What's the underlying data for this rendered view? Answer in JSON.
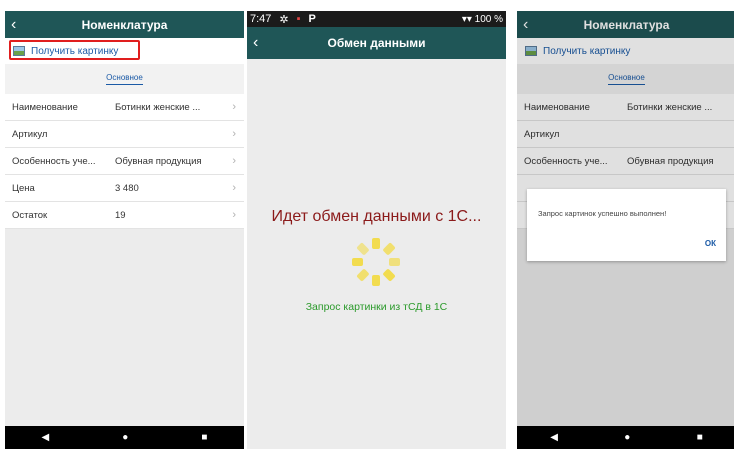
{
  "colors": {
    "appbar_teal": "#1f5657",
    "red_highlight": "#e01e1e",
    "link_blue": "#1b5aa6",
    "status_green": "#2b9a2b",
    "exchange_red": "#8b1a1a"
  },
  "screen1": {
    "back_icon": "‹",
    "title": "Номенклатура",
    "action_label": "Получить картинку",
    "tab": "Основное",
    "rows": [
      {
        "label": "Наименование",
        "value": "Ботинки женские ..."
      },
      {
        "label": "Артикул",
        "value": ""
      },
      {
        "label": "Особенность уче...",
        "value": "Обувная продукция"
      },
      {
        "label": "Цена",
        "value": "3 480"
      },
      {
        "label": "Остаток",
        "value": "19"
      }
    ],
    "nav": {
      "back": "◀",
      "home": "●",
      "recent": "■"
    }
  },
  "screen2": {
    "status": {
      "time": "7:47",
      "right": "▾▾ 100 %"
    },
    "back_icon": "‹",
    "title": "Обмен данными",
    "big_text": "Идет обмен данными с 1С...",
    "sub_status": "Запрос картинки  из  тСД в 1С"
  },
  "screen3": {
    "back_icon": "‹",
    "title": "Номенклатура",
    "action_label": "Получить картинку",
    "tab": "Основное",
    "rows": [
      {
        "label": "Наименование",
        "value": "Ботинки женские ..."
      },
      {
        "label": "Артикул",
        "value": ""
      },
      {
        "label": "Особенность уче...",
        "value": "Обувная продукция"
      }
    ],
    "dialog": {
      "message": "Запрос картинок успешно выполнен!",
      "ok": "ОК"
    },
    "nav": {
      "back": "◀",
      "home": "●",
      "recent": "■"
    }
  }
}
